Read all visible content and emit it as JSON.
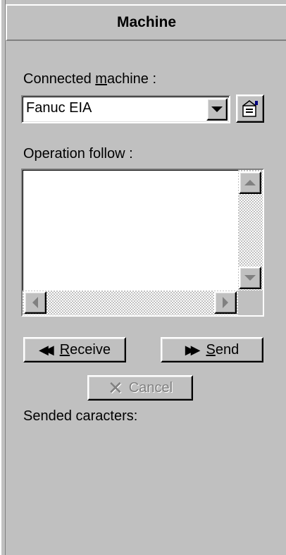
{
  "header": {
    "title": "Machine"
  },
  "machine": {
    "label_prefix": "Connected ",
    "label_accel": "m",
    "label_suffix": "achine :",
    "selected": "Fanuc EIA",
    "properties_icon": "properties-icon"
  },
  "operation": {
    "label": "Operation follow :",
    "log_text": ""
  },
  "buttons": {
    "receive": {
      "icon": "rewind-icon",
      "accel": "R",
      "rest": "eceive"
    },
    "send": {
      "icon": "fast-forward-icon",
      "accel": "S",
      "rest": "end"
    },
    "cancel": {
      "icon": "x-icon",
      "label": "Cancel",
      "enabled": false
    }
  },
  "status": {
    "sended_label": "Sended caracters:"
  },
  "colors": {
    "face": "#c0c0c0",
    "highlight": "#ffffff",
    "shadow": "#808080",
    "disabled_text": "#808080"
  }
}
